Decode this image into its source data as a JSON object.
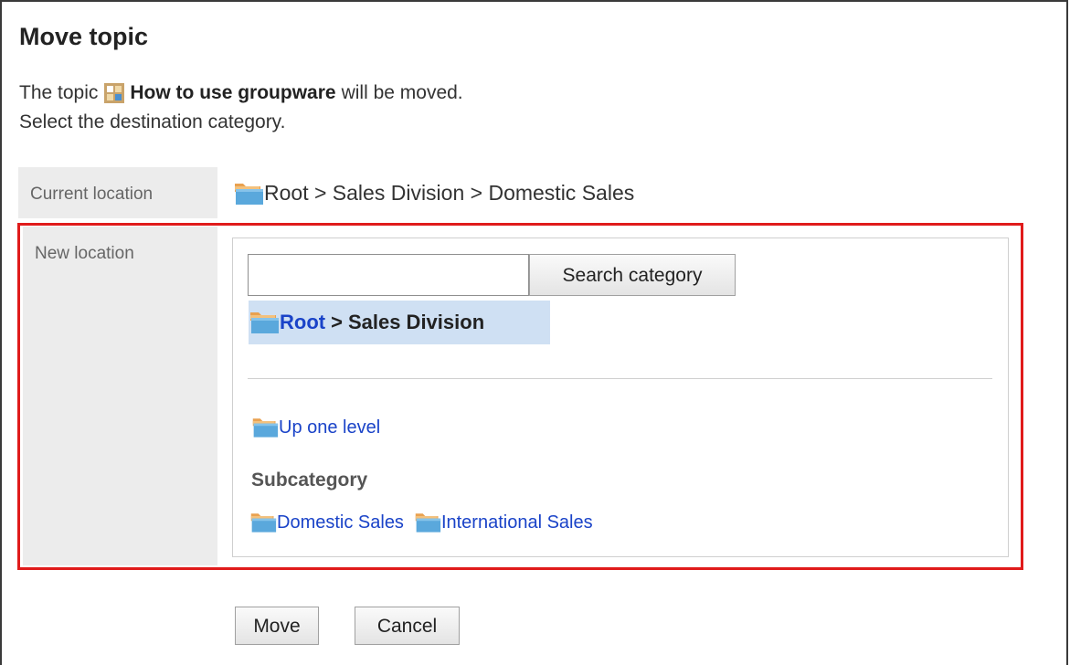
{
  "dialog": {
    "title": "Move topic",
    "line1_prefix": "The topic",
    "topic_name": "How to use groupware",
    "line1_suffix": "will be moved.",
    "line2": "Select the destination category."
  },
  "current_location": {
    "label": "Current location",
    "path": "Root > Sales Division > Domestic Sales"
  },
  "new_location": {
    "label": "New location",
    "search_input_value": "",
    "search_button_label": "Search category",
    "selected_root_label": "Root",
    "selected_separator": ">",
    "selected_current": "Sales Division",
    "up_one_level_label": "Up one level",
    "subcategory_heading": "Subcategory",
    "subcategories": [
      {
        "label": "Domestic Sales"
      },
      {
        "label": "International Sales"
      }
    ]
  },
  "actions": {
    "move_label": "Move",
    "cancel_label": "Cancel"
  },
  "colors": {
    "link": "#1a43c8",
    "highlight_frame": "#e01b1b",
    "selected_bg": "#cfe0f3",
    "label_bg": "#ececec"
  },
  "icons": {
    "topic": "topic-icon",
    "folder": "folder-icon"
  }
}
